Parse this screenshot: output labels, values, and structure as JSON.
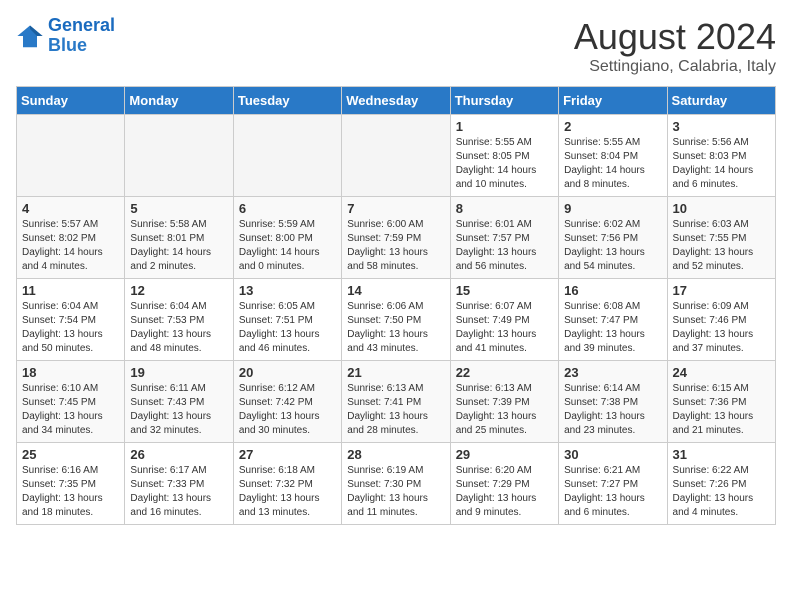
{
  "logo": {
    "line1": "General",
    "line2": "Blue"
  },
  "title": "August 2024",
  "location": "Settingiano, Calabria, Italy",
  "days_of_week": [
    "Sunday",
    "Monday",
    "Tuesday",
    "Wednesday",
    "Thursday",
    "Friday",
    "Saturday"
  ],
  "weeks": [
    [
      {
        "day": "",
        "info": ""
      },
      {
        "day": "",
        "info": ""
      },
      {
        "day": "",
        "info": ""
      },
      {
        "day": "",
        "info": ""
      },
      {
        "day": "1",
        "info": "Sunrise: 5:55 AM\nSunset: 8:05 PM\nDaylight: 14 hours\nand 10 minutes."
      },
      {
        "day": "2",
        "info": "Sunrise: 5:55 AM\nSunset: 8:04 PM\nDaylight: 14 hours\nand 8 minutes."
      },
      {
        "day": "3",
        "info": "Sunrise: 5:56 AM\nSunset: 8:03 PM\nDaylight: 14 hours\nand 6 minutes."
      }
    ],
    [
      {
        "day": "4",
        "info": "Sunrise: 5:57 AM\nSunset: 8:02 PM\nDaylight: 14 hours\nand 4 minutes."
      },
      {
        "day": "5",
        "info": "Sunrise: 5:58 AM\nSunset: 8:01 PM\nDaylight: 14 hours\nand 2 minutes."
      },
      {
        "day": "6",
        "info": "Sunrise: 5:59 AM\nSunset: 8:00 PM\nDaylight: 14 hours\nand 0 minutes."
      },
      {
        "day": "7",
        "info": "Sunrise: 6:00 AM\nSunset: 7:59 PM\nDaylight: 13 hours\nand 58 minutes."
      },
      {
        "day": "8",
        "info": "Sunrise: 6:01 AM\nSunset: 7:57 PM\nDaylight: 13 hours\nand 56 minutes."
      },
      {
        "day": "9",
        "info": "Sunrise: 6:02 AM\nSunset: 7:56 PM\nDaylight: 13 hours\nand 54 minutes."
      },
      {
        "day": "10",
        "info": "Sunrise: 6:03 AM\nSunset: 7:55 PM\nDaylight: 13 hours\nand 52 minutes."
      }
    ],
    [
      {
        "day": "11",
        "info": "Sunrise: 6:04 AM\nSunset: 7:54 PM\nDaylight: 13 hours\nand 50 minutes."
      },
      {
        "day": "12",
        "info": "Sunrise: 6:04 AM\nSunset: 7:53 PM\nDaylight: 13 hours\nand 48 minutes."
      },
      {
        "day": "13",
        "info": "Sunrise: 6:05 AM\nSunset: 7:51 PM\nDaylight: 13 hours\nand 46 minutes."
      },
      {
        "day": "14",
        "info": "Sunrise: 6:06 AM\nSunset: 7:50 PM\nDaylight: 13 hours\nand 43 minutes."
      },
      {
        "day": "15",
        "info": "Sunrise: 6:07 AM\nSunset: 7:49 PM\nDaylight: 13 hours\nand 41 minutes."
      },
      {
        "day": "16",
        "info": "Sunrise: 6:08 AM\nSunset: 7:47 PM\nDaylight: 13 hours\nand 39 minutes."
      },
      {
        "day": "17",
        "info": "Sunrise: 6:09 AM\nSunset: 7:46 PM\nDaylight: 13 hours\nand 37 minutes."
      }
    ],
    [
      {
        "day": "18",
        "info": "Sunrise: 6:10 AM\nSunset: 7:45 PM\nDaylight: 13 hours\nand 34 minutes."
      },
      {
        "day": "19",
        "info": "Sunrise: 6:11 AM\nSunset: 7:43 PM\nDaylight: 13 hours\nand 32 minutes."
      },
      {
        "day": "20",
        "info": "Sunrise: 6:12 AM\nSunset: 7:42 PM\nDaylight: 13 hours\nand 30 minutes."
      },
      {
        "day": "21",
        "info": "Sunrise: 6:13 AM\nSunset: 7:41 PM\nDaylight: 13 hours\nand 28 minutes."
      },
      {
        "day": "22",
        "info": "Sunrise: 6:13 AM\nSunset: 7:39 PM\nDaylight: 13 hours\nand 25 minutes."
      },
      {
        "day": "23",
        "info": "Sunrise: 6:14 AM\nSunset: 7:38 PM\nDaylight: 13 hours\nand 23 minutes."
      },
      {
        "day": "24",
        "info": "Sunrise: 6:15 AM\nSunset: 7:36 PM\nDaylight: 13 hours\nand 21 minutes."
      }
    ],
    [
      {
        "day": "25",
        "info": "Sunrise: 6:16 AM\nSunset: 7:35 PM\nDaylight: 13 hours\nand 18 minutes."
      },
      {
        "day": "26",
        "info": "Sunrise: 6:17 AM\nSunset: 7:33 PM\nDaylight: 13 hours\nand 16 minutes."
      },
      {
        "day": "27",
        "info": "Sunrise: 6:18 AM\nSunset: 7:32 PM\nDaylight: 13 hours\nand 13 minutes."
      },
      {
        "day": "28",
        "info": "Sunrise: 6:19 AM\nSunset: 7:30 PM\nDaylight: 13 hours\nand 11 minutes."
      },
      {
        "day": "29",
        "info": "Sunrise: 6:20 AM\nSunset: 7:29 PM\nDaylight: 13 hours\nand 9 minutes."
      },
      {
        "day": "30",
        "info": "Sunrise: 6:21 AM\nSunset: 7:27 PM\nDaylight: 13 hours\nand 6 minutes."
      },
      {
        "day": "31",
        "info": "Sunrise: 6:22 AM\nSunset: 7:26 PM\nDaylight: 13 hours\nand 4 minutes."
      }
    ]
  ]
}
